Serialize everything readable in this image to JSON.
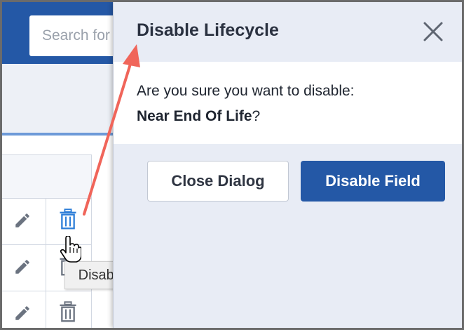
{
  "background": {
    "search_placeholder": "Search for",
    "rows": [
      {
        "edit_icon": "pencil-icon",
        "delete_icon": "trash-icon",
        "delete_state": "hover"
      },
      {
        "edit_icon": "pencil-icon",
        "delete_icon": "trash-icon",
        "delete_state": "normal"
      },
      {
        "edit_icon": "pencil-icon",
        "delete_icon": "trash-icon",
        "delete_state": "normal"
      }
    ],
    "tooltip": "Disable"
  },
  "dialog": {
    "title": "Disable Lifecycle",
    "question": "Are you sure you want to disable:",
    "item_name": "Near End Of Life",
    "item_suffix": "?",
    "close_icon": "close-icon",
    "secondary_button": "Close Dialog",
    "primary_button": "Disable Field"
  },
  "annotation": {
    "type": "arrow",
    "color": "#f0655a"
  },
  "colors": {
    "brand": "#2458a6",
    "link_blue": "#2f7fd8",
    "panel_bg": "#e8ecf5",
    "text_dark": "#2a3140"
  }
}
